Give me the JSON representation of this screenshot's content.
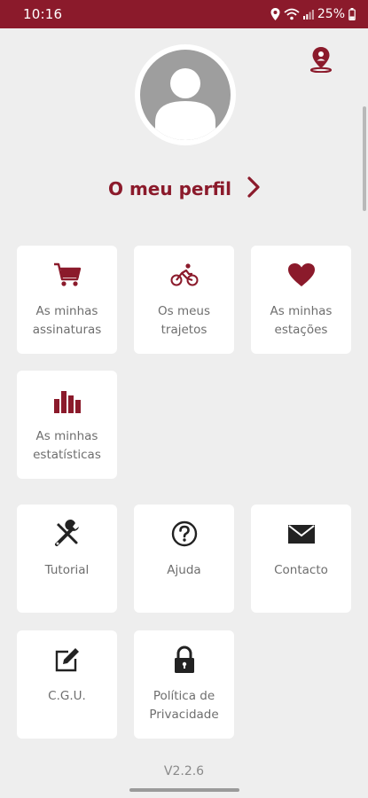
{
  "status_bar": {
    "time": "10:16",
    "battery": "25%",
    "icons": [
      "location-icon",
      "wifi-icon",
      "signal-icon",
      "battery-icon"
    ]
  },
  "colors": {
    "accent": "#8b1a2b",
    "background": "#eeeeee",
    "tile": "#ffffff",
    "text_muted": "#6e6e6e",
    "avatar": "#9e9e9e"
  },
  "header": {
    "location_icon": "map-pin-icon"
  },
  "profile": {
    "avatar_icon": "person-icon",
    "label": "O meu perfil",
    "chevron_icon": "chevron-right-icon"
  },
  "tiles": [
    {
      "label": "As minhas\nassinaturas",
      "icon": "cart-icon"
    },
    {
      "label": "Os meus\ntrajetos",
      "icon": "bicycle-icon"
    },
    {
      "label": "As minhas\nestações",
      "icon": "heart-icon"
    },
    {
      "label": "As minhas\nestatísticas",
      "icon": "bar-chart-icon"
    },
    {
      "label": "Tutorial",
      "icon": "tools-icon"
    },
    {
      "label": "Ajuda",
      "icon": "help-icon"
    },
    {
      "label": "Contacto",
      "icon": "mail-icon"
    },
    {
      "label": "C.G.U.",
      "icon": "edit-icon"
    },
    {
      "label": "Política de\nPrivacidade",
      "icon": "lock-icon"
    }
  ],
  "version": "V2.2.6"
}
